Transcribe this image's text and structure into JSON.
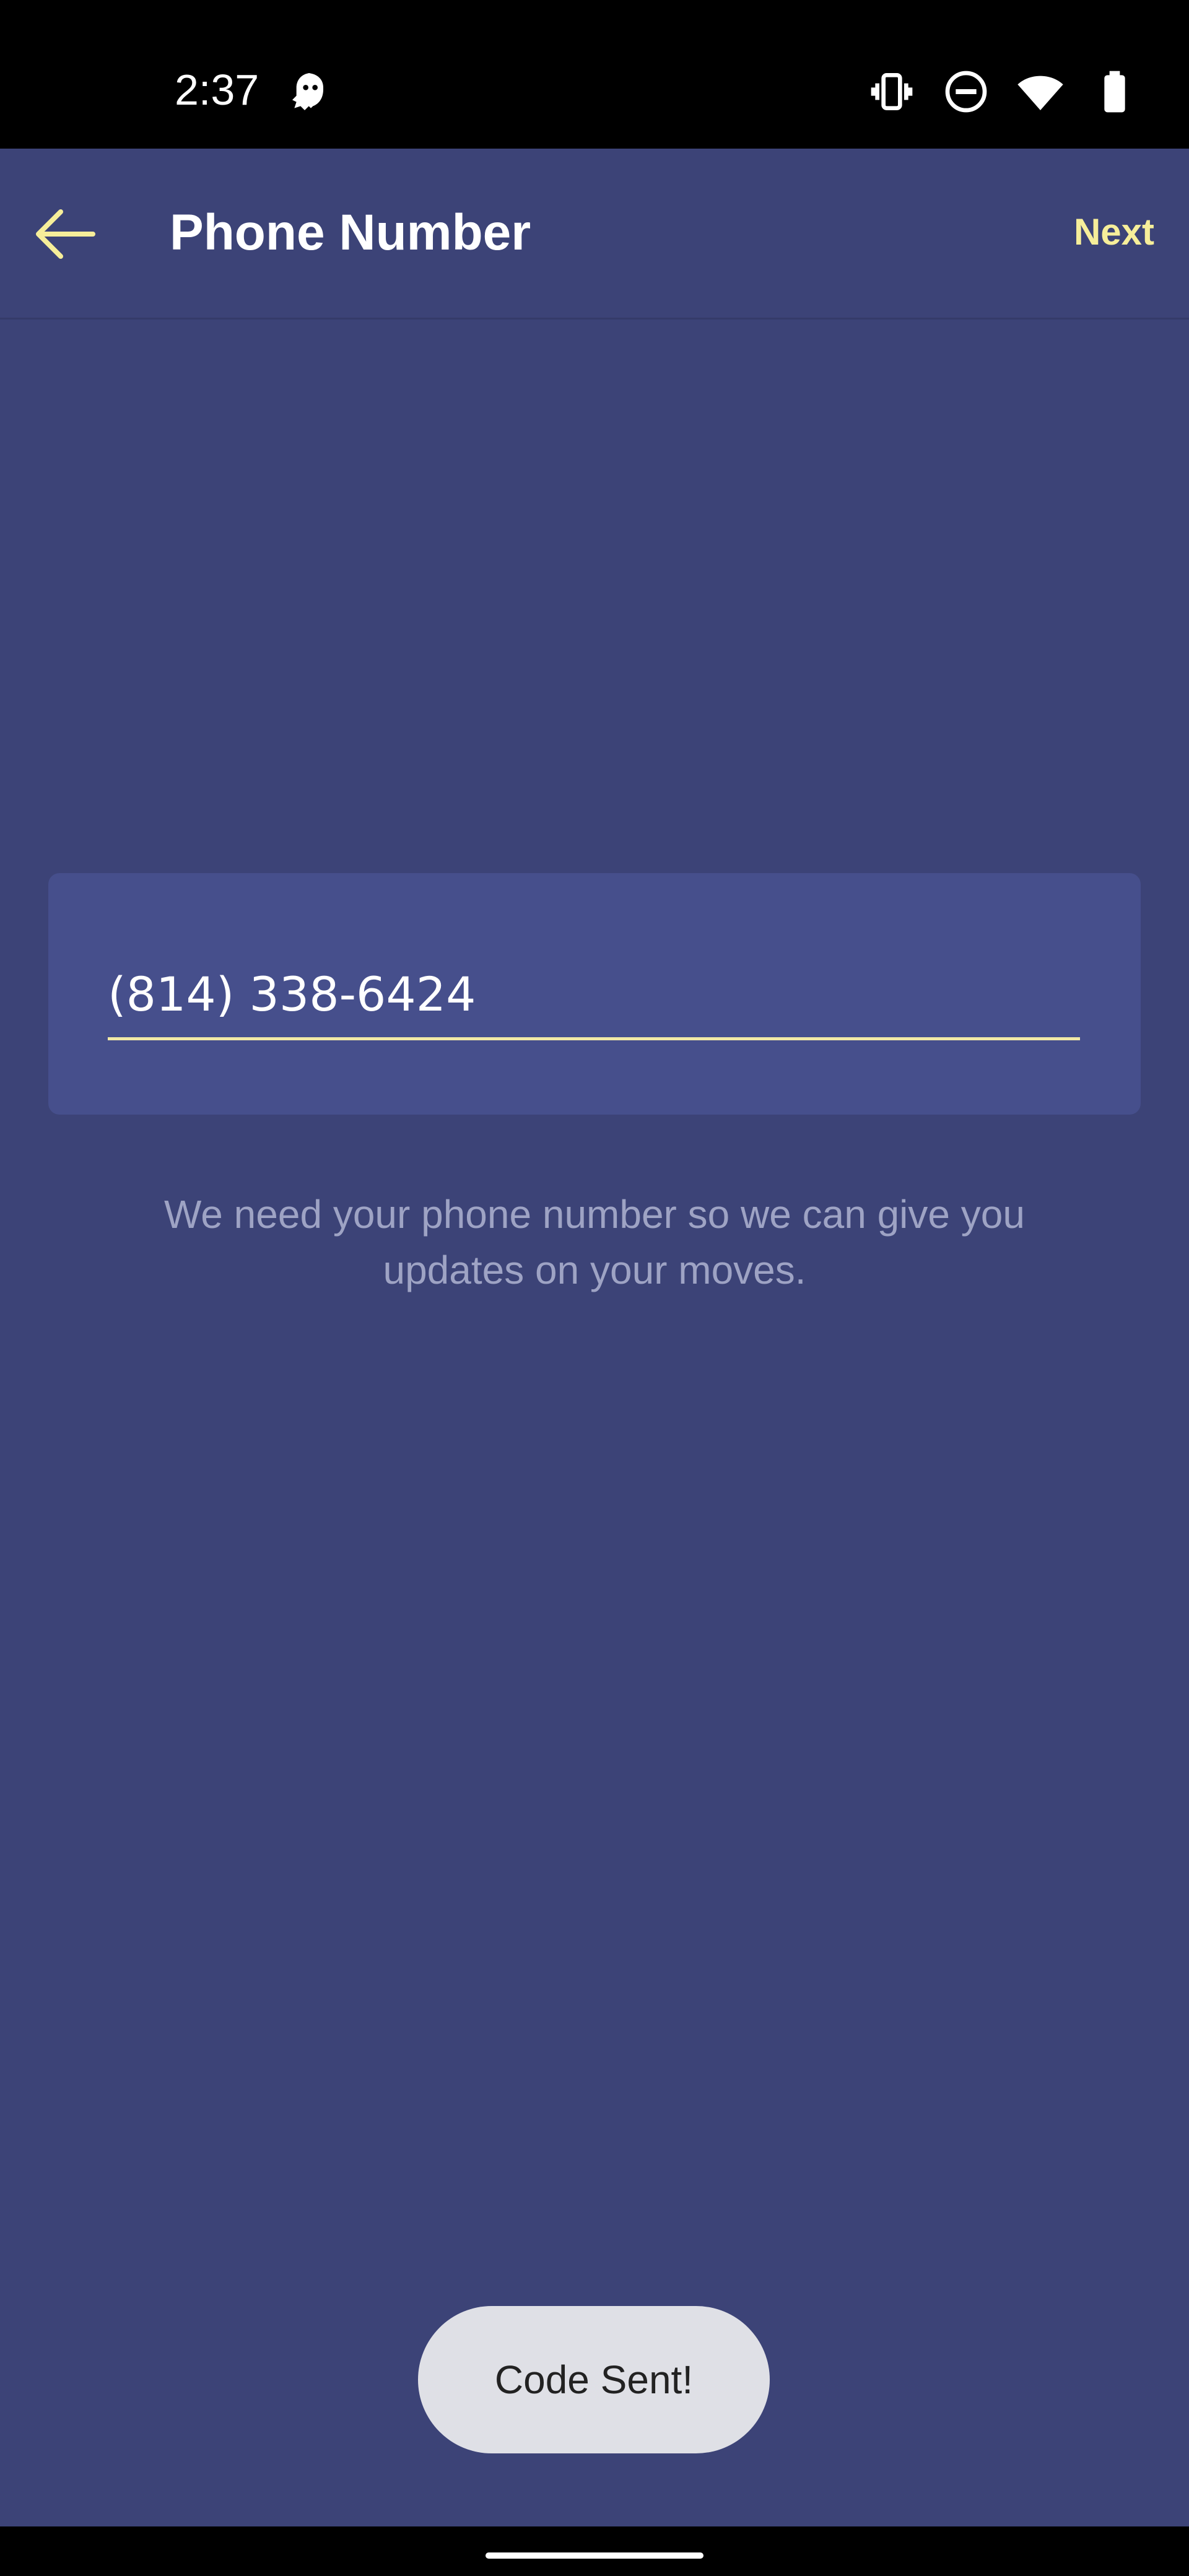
{
  "status_bar": {
    "time": "2:37",
    "icons": [
      "ghost-icon",
      "vibrate-icon",
      "do-not-disturb-icon",
      "wifi-icon",
      "battery-icon"
    ]
  },
  "app_bar": {
    "title": "Phone Number",
    "next_label": "Next",
    "back_icon": "arrow-left-icon"
  },
  "phone_form": {
    "value": "(814) 338-6424",
    "helper_text": "We need your phone number so we can give you updates on your moves."
  },
  "toast": {
    "message": "Code Sent!"
  },
  "colors": {
    "background": "#3c4377",
    "card": "#464f8c",
    "accent": "#f6ee9a",
    "helper_text": "#9ea3c4"
  }
}
